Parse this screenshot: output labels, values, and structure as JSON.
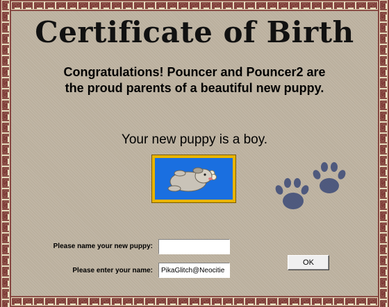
{
  "certificate": {
    "title": "Certificate of Birth",
    "congrats_line1": "Congratulations! Pouncer and Pouncer2 are",
    "congrats_line2": "the proud parents of a beautiful new puppy.",
    "gender_text": "Your new puppy is a boy."
  },
  "form": {
    "puppy_name_label": "Please name your new puppy:",
    "puppy_name_value": "",
    "owner_name_label": "Please enter your name:",
    "owner_name_value": "PikaGlitch@Neocitie",
    "ok_label": "OK"
  },
  "icons": {
    "border": "greek-key-border",
    "puppy": "puppy-picture",
    "paws": "paw-prints-icon"
  },
  "colors": {
    "border_brown": "#6b1f1f",
    "border_cream": "#e8dcc0",
    "background": "#bbb09e",
    "puppy_frame_gold": "#e8b400",
    "puppy_frame_bg": "#1a6fe0",
    "paw_color": "#3c4a78"
  }
}
